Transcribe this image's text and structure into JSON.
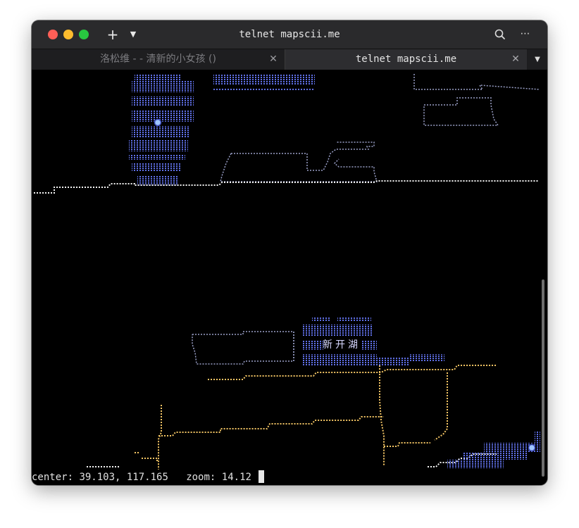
{
  "window": {
    "title": "telnet mapscii.me",
    "controls": {
      "close": "close-icon",
      "minimize": "minimize-icon",
      "maximize": "maximize-icon"
    },
    "new_tab_glyph": "+",
    "more_glyph": "⋯"
  },
  "tabs": [
    {
      "label": "洛松维 -  - 清新的小女孩 ()",
      "close": "✕",
      "active": false
    },
    {
      "label": "telnet mapscii.me",
      "close": "✕",
      "active": true
    }
  ],
  "map": {
    "lake_label": "新开湖",
    "colors": {
      "water": "#5f6fe6",
      "road": "#f2c464",
      "white_road": "#f4f4f4",
      "building": "#9aa0c8",
      "marker": "#9fc6ff"
    }
  },
  "status": {
    "center_label": "center:",
    "center_value": "39.103, 117.165",
    "zoom_label": "zoom:",
    "zoom_value": "14.12"
  }
}
